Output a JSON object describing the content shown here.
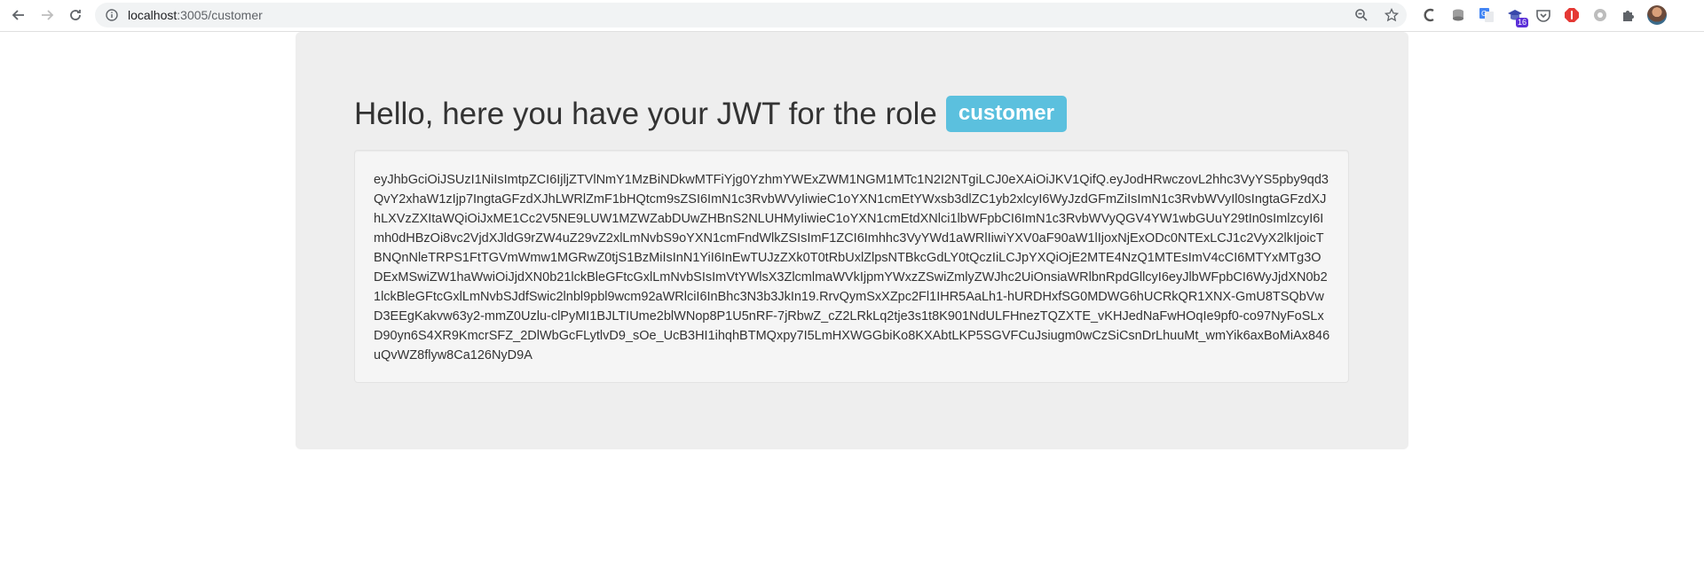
{
  "browser": {
    "url_host": "localhost",
    "url_path": ":3005/customer",
    "extension_badge": "16"
  },
  "page": {
    "heading": "Hello, here you have your JWT for the role",
    "role": "customer",
    "token": "eyJhbGciOiJSUzI1NiIsImtpZCI6IjljZTVlNmY1MzBiNDkwMTFiYjg0YzhmYWExZWM1NGM1MTc1N2I2NTgiLCJ0eXAiOiJKV1QifQ.eyJodHRwczovL2hhc3VyYS5pby9qd3QvY2xhaW1zIjp7IngtaGFzdXJhLWRlZmF1bHQtcm9sZSI6ImN1c3RvbWVyIiwieC1oYXN1cmEtYWxsb3dlZC1yb2xlcyI6WyJzdGFmZiIsImN1c3RvbWVyIl0sIngtaGFzdXJhLXVzZXItaWQiOiJxME1Cc2V5NE9LUW1MZWZabDUwZHBnS2NLUHMyIiwieC1oYXN1cmEtdXNlci1lbWFpbCI6ImN1c3RvbWVyQGV4YW1wbGUuY29tIn0sImlzcyI6Imh0dHBzOi8vc2VjdXJldG9rZW4uZ29vZ2xlLmNvbS9oYXN1cmFndWlkZSIsImF1ZCI6Imhhc3VyYWd1aWRlIiwiYXV0aF90aW1lIjoxNjExODc0NTExLCJ1c2VyX2lkIjoicTBNQnNleTRPS1FtTGVmWmw1MGRwZ0tjS1BzMiIsInN1YiI6InEwTUJzZXk0T0tRbUxlZlpsNTBkcGdLY0tQczIiLCJpYXQiOjE2MTE4NzQ1MTEsImV4cCI6MTYxMTg3ODExMSwiZW1haWwiOiJjdXN0b21lckBleGFtcGxlLmNvbSIsImVtYWlsX3ZlcmlmaWVkIjpmYWxzZSwiZmlyZWJhc2UiOnsiaWRlbnRpdGllcyI6eyJlbWFpbCI6WyJjdXN0b21lckBleGFtcGxlLmNvbSJdfSwic2lnbl9pbl9wcm92aWRlciI6InBhc3N3b3JkIn19.RrvQymSxXZpc2Fl1IHR5AaLh1-hURDHxfSG0MDWG6hUCRkQR1XNX-GmU8TSQbVwD3EEgKakvw63y2-mmZ0Uzlu-clPyMI1BJLTIUme2blWNop8P1U5nRF-7jRbwZ_cZ2LRkLq2tje3s1t8K901NdULFHnezTQZXTE_vKHJedNaFwHOqIe9pf0-co97NyFoSLxD90yn6S4XR9KmcrSFZ_2DlWbGcFLytlvD9_sOe_UcB3HI1ihqhBTMQxpy7I5LmHXWGGbiKo8KXAbtLKP5SGVFCuJsiugm0wCzSiCsnDrLhuuMt_wmYik6axBoMiAx846uQvWZ8flyw8Ca126NyD9A"
  }
}
